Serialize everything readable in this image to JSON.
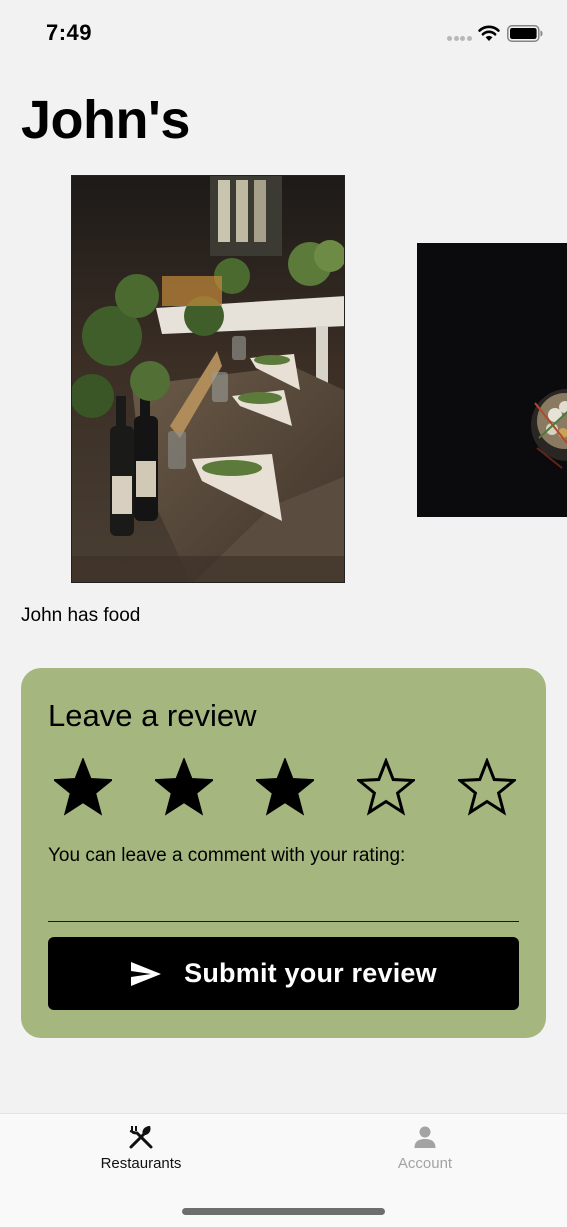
{
  "status_bar": {
    "time": "7:49",
    "signal_icon": "signal-dots-icon",
    "wifi_icon": "wifi-icon",
    "battery_icon": "battery-full-icon"
  },
  "restaurant": {
    "name": "John's",
    "description": "John has food",
    "photos": [
      {
        "icon": "photo-rustic-dining-table"
      },
      {
        "icon": "photo-dark-dish"
      }
    ]
  },
  "review": {
    "title": "Leave a review",
    "rating": 3,
    "max_rating": 5,
    "comment_label": "You can leave a comment with your rating:",
    "comment_value": "",
    "comment_placeholder": "",
    "submit_label": "Submit your review",
    "submit_icon": "send-icon",
    "card_color": "#a5b77f"
  },
  "tab_bar": {
    "tabs": [
      {
        "label": "Restaurants",
        "icon": "fork-knife-icon",
        "active": true
      },
      {
        "label": "Account",
        "icon": "person-icon",
        "active": false
      }
    ],
    "active_color": "#111111",
    "inactive_color": "#a3a3a3"
  }
}
